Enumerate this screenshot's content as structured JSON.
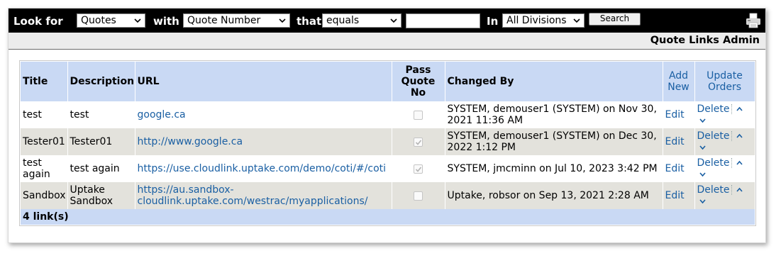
{
  "search": {
    "look_for_label": "Look for",
    "look_for_value": "Quotes",
    "with_label": "with",
    "with_value": "Quote Number",
    "that_label": "that",
    "that_value": "equals",
    "query_value": "",
    "in_label": "In",
    "in_value": "All Divisions",
    "search_button": "Search"
  },
  "page_title": "Quote Links Admin",
  "table": {
    "headers": {
      "title": "Title",
      "description": "Description",
      "url": "URL",
      "pass_quote_no_1": "Pass",
      "pass_quote_no_2": "Quote",
      "pass_quote_no_3": "No",
      "changed_by": "Changed By",
      "add_new_1": "Add",
      "add_new_2": "New",
      "update_orders_1": "Update",
      "update_orders_2": "Orders"
    },
    "rows": [
      {
        "title": "test",
        "description": "test",
        "url": "google.ca",
        "pass_quote_no": false,
        "changed_by": "SYSTEM, demouser1 (SYSTEM) on Nov 30, 2021 11:36 AM",
        "edit": "Edit",
        "delete": "Delete"
      },
      {
        "title": "Tester01",
        "description": "Tester01",
        "url": "http://www.google.ca",
        "pass_quote_no": true,
        "changed_by": "SYSTEM, demouser1 (SYSTEM) on Dec 30, 2022 1:12 PM",
        "edit": "Edit",
        "delete": "Delete"
      },
      {
        "title": "test again",
        "description": "test again",
        "url": "https://use.cloudlink.uptake.com/demo/coti/#/coti",
        "pass_quote_no": true,
        "changed_by": "SYSTEM, jmcminn on Jul 10, 2023 3:42 PM",
        "edit": "Edit",
        "delete": "Delete"
      },
      {
        "title": "Sandbox",
        "description": "Uptake Sandbox",
        "url": "https://au.sandbox-cloudlink.uptake.com/westrac/myapplications/",
        "pass_quote_no": false,
        "changed_by": "Uptake, robsor on Sep 13, 2021 2:28 AM",
        "edit": "Edit",
        "delete": "Delete"
      }
    ],
    "footer": "4 link(s)"
  },
  "icons": {
    "printer": "printer-icon",
    "move_up": "chevron-up-icon",
    "move_down": "chevron-down-icon",
    "dropdown": "dropdown-chevron-icon"
  },
  "colors": {
    "search_bar": "#000000",
    "header_bg": "#c9d9f4",
    "alt_row_bg": "#e3e2dc",
    "link": "#1a5fa3"
  }
}
